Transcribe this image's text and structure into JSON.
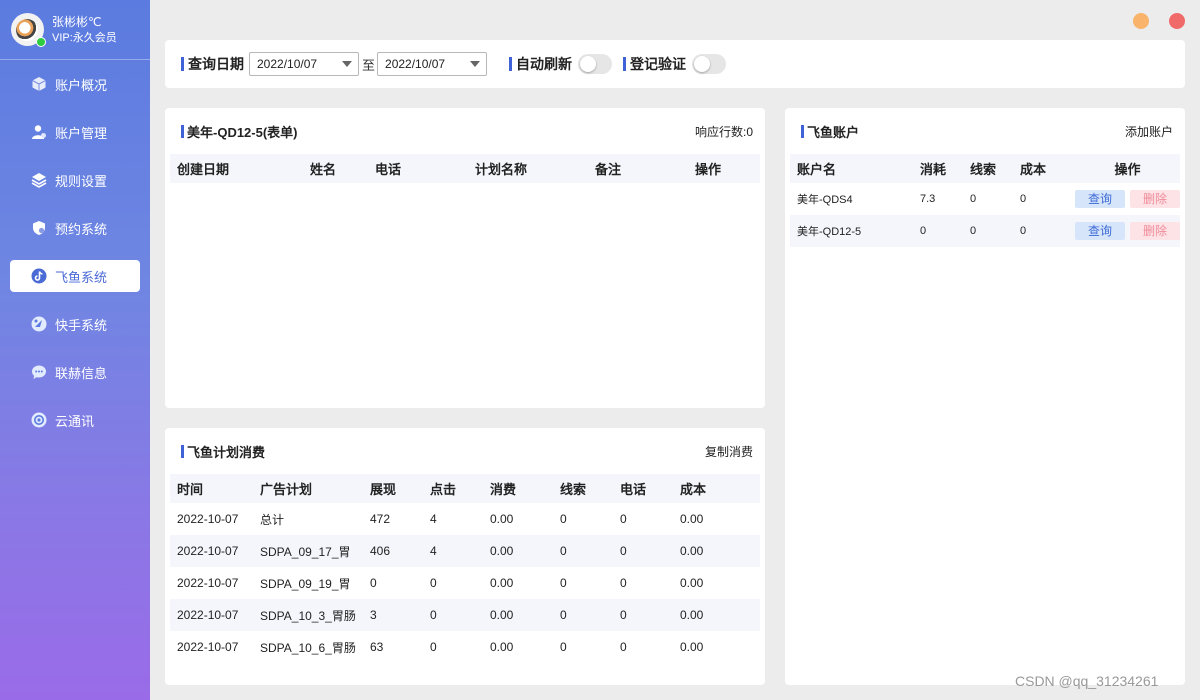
{
  "profile": {
    "name": "张彬彬℃",
    "vip": "VIP:永久会员"
  },
  "nav": [
    {
      "label": "账户概况",
      "icon": "cube-icon"
    },
    {
      "label": "账户管理",
      "icon": "user-icon"
    },
    {
      "label": "规则设置",
      "icon": "layers-icon"
    },
    {
      "label": "预约系统",
      "icon": "shield-icon"
    },
    {
      "label": "飞鱼系统",
      "icon": "tiktok-icon",
      "active": true
    },
    {
      "label": "快手系统",
      "icon": "kuaishou-icon"
    },
    {
      "label": "联赫信息",
      "icon": "chat-icon"
    },
    {
      "label": "云通讯",
      "icon": "cloud-chat-icon"
    }
  ],
  "filter": {
    "date_label": "查询日期",
    "start_date": "2022/10/07",
    "to": "至",
    "end_date": "2022/10/07",
    "auto_refresh_label": "自动刷新",
    "auto_refresh_on": false,
    "login_verify_label": "登记验证",
    "login_verify_on": false
  },
  "form_panel": {
    "title": "美年-QD12-5(表单)",
    "response_count": "响应行数:0",
    "columns": [
      "创建日期",
      "姓名",
      "电话",
      "计划名称",
      "备注",
      "操作"
    ]
  },
  "plan_panel": {
    "title": "飞鱼计划消费",
    "action": "复制消费",
    "columns": [
      "时间",
      "广告计划",
      "展现",
      "点击",
      "消费",
      "线索",
      "电话",
      "成本"
    ],
    "rows": [
      [
        "2022-10-07",
        "总计",
        "472",
        "4",
        "0.00",
        "0",
        "0",
        "0.00"
      ],
      [
        "2022-10-07",
        "SDPA_09_17_胃",
        "406",
        "4",
        "0.00",
        "0",
        "0",
        "0.00"
      ],
      [
        "2022-10-07",
        "SDPA_09_19_胃",
        "0",
        "0",
        "0.00",
        "0",
        "0",
        "0.00"
      ],
      [
        "2022-10-07",
        "SDPA_10_3_胃肠",
        "3",
        "0",
        "0.00",
        "0",
        "0",
        "0.00"
      ],
      [
        "2022-10-07",
        "SDPA_10_6_胃肠",
        "63",
        "0",
        "0.00",
        "0",
        "0",
        "0.00"
      ]
    ]
  },
  "account_panel": {
    "title": "飞鱼账户",
    "action": "添加账户",
    "columns": [
      "账户名",
      "消耗",
      "线索",
      "成本",
      "操作"
    ],
    "query_label": "查询",
    "delete_label": "删除",
    "rows": [
      [
        "美年-QDS4",
        "7.3",
        "0",
        "0"
      ],
      [
        "美年-QD12-5",
        "0",
        "0",
        "0"
      ]
    ]
  },
  "watermark": "CSDN @qq_31234261",
  "colors": {
    "accent": "#3f63d6",
    "sidebar_top": "#5b7be0",
    "sidebar_bottom": "#9a6be8",
    "minimize": "#f9b36b",
    "close": "#f16a6a"
  }
}
